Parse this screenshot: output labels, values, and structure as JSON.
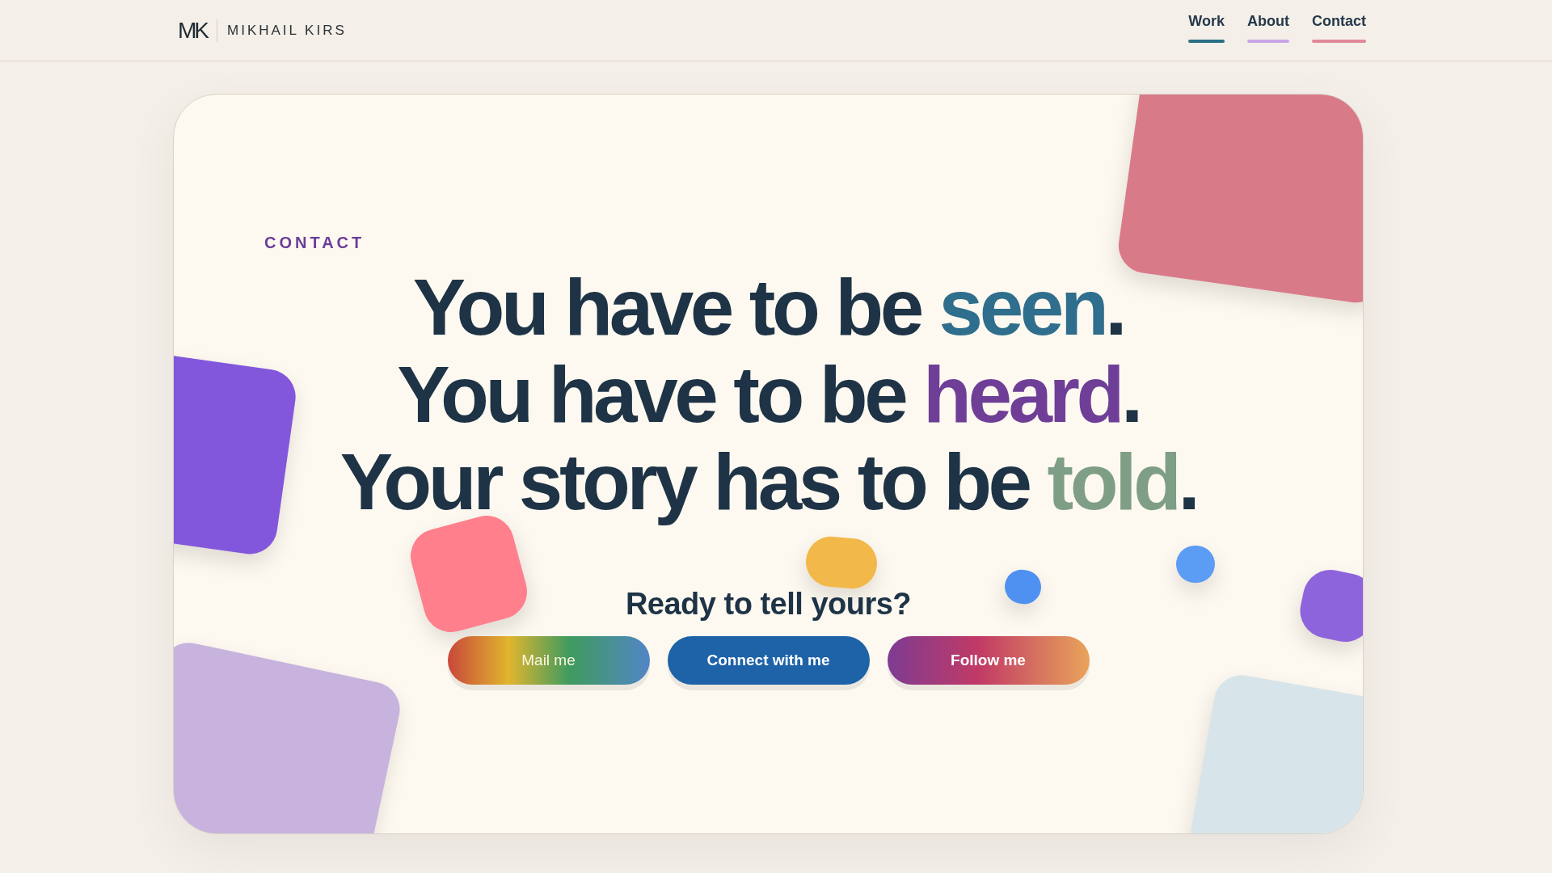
{
  "brand": {
    "monogram": "MK",
    "name": "MIKHAIL KIRS"
  },
  "nav": [
    {
      "label": "Work",
      "color": "#2a6f86"
    },
    {
      "label": "About",
      "color": "#c8a6e6"
    },
    {
      "label": "Contact",
      "color": "#e08a98"
    }
  ],
  "hero": {
    "eyebrow": "CONTACT",
    "lines": [
      {
        "lead": "You have to be",
        "accent": {
          "text": "seen",
          "color": "#2f6e8c"
        },
        "end": "."
      },
      {
        "lead": "You have to be",
        "accent": {
          "text": "heard",
          "color": "#6f3f97"
        },
        "end": "."
      },
      {
        "lead": "Your story has to be",
        "accent": {
          "text": "told",
          "color": "#7f9e86"
        },
        "end": "."
      }
    ],
    "prompt": "Ready to tell yours?",
    "buttons": [
      {
        "label": "Mail me",
        "kind": "rainbow"
      },
      {
        "label": "Connect with me",
        "kind": "solid"
      },
      {
        "label": "Follow me",
        "kind": "sunset"
      }
    ]
  }
}
